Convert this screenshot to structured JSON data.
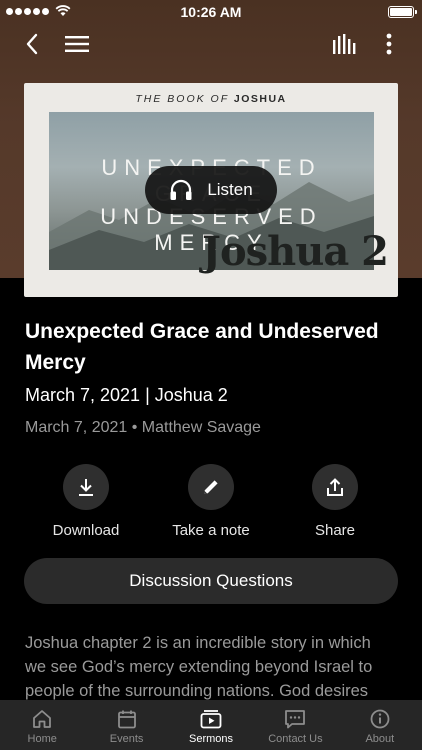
{
  "status_bar": {
    "time": "10:26 AM"
  },
  "artwork": {
    "header_prefix": "THE BOOK OF",
    "header_book": "JOSHUA",
    "line1": "UNEXPECTED GRACE",
    "line2": "UNDESERVED MERCY",
    "series_label": "Joshua 2"
  },
  "listen_label": "Listen",
  "sermon": {
    "title": "Unexpected Grace and Undeserved Mercy",
    "subtitle": "March 7, 2021 | Joshua 2",
    "meta": "March 7, 2021 • Matthew Savage"
  },
  "actions": {
    "download": "Download",
    "note": "Take a note",
    "share": "Share"
  },
  "discussion_label": "Discussion Questions",
  "description": "Joshua chapter 2 is an incredible story in which we see God’s mercy extending beyond Israel to people of the surrounding nations. God desires",
  "tabs": {
    "home": "Home",
    "events": "Events",
    "sermons": "Sermons",
    "contact": "Contact Us",
    "about": "About"
  },
  "active_tab": "Sermons",
  "icons": [
    "back-icon",
    "menu-icon",
    "equalizer-icon",
    "more-icon",
    "headphones-icon",
    "download-icon",
    "pencil-icon",
    "share-icon",
    "home-icon",
    "calendar-icon",
    "play-icon",
    "chat-icon",
    "info-icon"
  ],
  "colors": {
    "header_bg": "#55392a",
    "background": "#000000",
    "button_bg": "#2b2b2b",
    "tabbar_bg": "#262626",
    "muted_text": "#9a9a9a"
  }
}
